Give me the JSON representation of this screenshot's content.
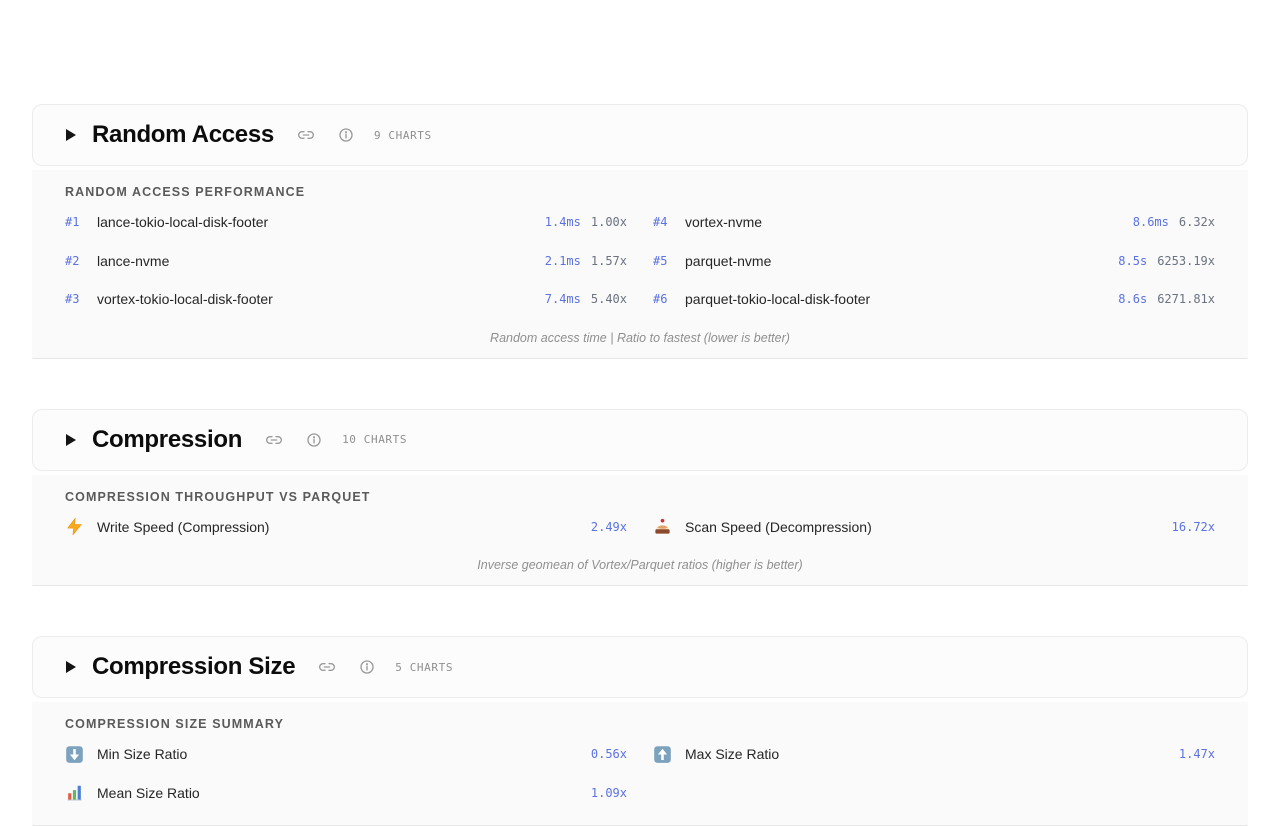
{
  "colors": {
    "accent_value": "#5b72e3",
    "ratio_muted": "#6b7280",
    "summary_bg": "#fafafa",
    "header_border": "#ececec"
  },
  "icons": {
    "disclosure": "right-triangle",
    "link": "chain-link",
    "info": "circled-i",
    "write_speed": "lightning-bolt",
    "scan_speed": "cake-slice",
    "min_ratio": "down-arrow-button",
    "max_ratio": "up-arrow-button",
    "mean_ratio": "bar-chart"
  },
  "sections": [
    {
      "title": "Random Access",
      "charts_label": "9 CHARTS",
      "summary_title": "RANDOM ACCESS PERFORMANCE",
      "rows": [
        {
          "rank": "#1",
          "name": "lance-tokio-local-disk-footer",
          "value": "1.4ms",
          "ratio": "1.00x"
        },
        {
          "rank": "#2",
          "name": "lance-nvme",
          "value": "2.1ms",
          "ratio": "1.57x"
        },
        {
          "rank": "#3",
          "name": "vortex-tokio-local-disk-footer",
          "value": "7.4ms",
          "ratio": "5.40x"
        },
        {
          "rank": "#4",
          "name": "vortex-nvme",
          "value": "8.6ms",
          "ratio": "6.32x"
        },
        {
          "rank": "#5",
          "name": "parquet-nvme",
          "value": "8.5s",
          "ratio": "6253.19x"
        },
        {
          "rank": "#6",
          "name": "parquet-tokio-local-disk-footer",
          "value": "8.6s",
          "ratio": "6271.81x"
        }
      ],
      "caption": "Random access time | Ratio to fastest (lower is better)"
    },
    {
      "title": "Compression",
      "charts_label": "10 CHARTS",
      "summary_title": "COMPRESSION THROUGHPUT VS PARQUET",
      "metrics": [
        {
          "icon": "lightning-bolt",
          "label": "Write Speed (Compression)",
          "value": "2.49x"
        },
        {
          "icon": "cake-slice",
          "label": "Scan Speed (Decompression)",
          "value": "16.72x"
        }
      ],
      "caption": "Inverse geomean of Vortex/Parquet ratios (higher is better)"
    },
    {
      "title": "Compression Size",
      "charts_label": "5 CHARTS",
      "summary_title": "COMPRESSION SIZE SUMMARY",
      "metrics": [
        {
          "icon": "down-arrow-button",
          "label": "Min Size Ratio",
          "value": "0.56x"
        },
        {
          "icon": "up-arrow-button",
          "label": "Max Size Ratio",
          "value": "1.47x"
        },
        {
          "icon": "bar-chart",
          "label": "Mean Size Ratio",
          "value": "1.09x"
        }
      ]
    }
  ]
}
